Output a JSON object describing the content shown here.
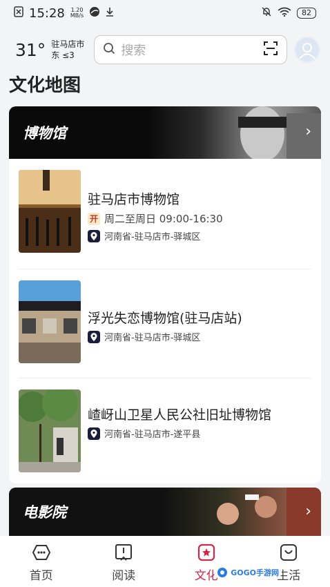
{
  "status_bar": {
    "time": "15:28",
    "speed_value": "1.20",
    "speed_unit": "MB/s",
    "battery": "82"
  },
  "header": {
    "temperature": "31°",
    "location_line1": "驻马店市",
    "location_line2": "东 ≤3",
    "search_placeholder": "搜索"
  },
  "section_title": "文化地图",
  "museum_card": {
    "banner_title": "博物馆",
    "items": [
      {
        "title": "驻马店市博物馆",
        "open_badge": "开",
        "hours": "周二至周日 09:00-16:30",
        "address": "河南省-驻马店市-驿城区"
      },
      {
        "title": "浮光失恋博物馆(驻马店站)",
        "address": "河南省-驻马店市-驿城区"
      },
      {
        "title": "嵖岈山卫星人民公社旧址博物馆",
        "address": "河南省-驻马店市-遂平县"
      }
    ]
  },
  "cinema_card": {
    "banner_title": "电影院"
  },
  "bottom_nav": {
    "items": [
      {
        "label": "首页"
      },
      {
        "label": "阅读"
      },
      {
        "label": "文化"
      },
      {
        "label": "生活"
      }
    ],
    "active_color": "#d0284c"
  },
  "watermark": "GOGO手游网"
}
